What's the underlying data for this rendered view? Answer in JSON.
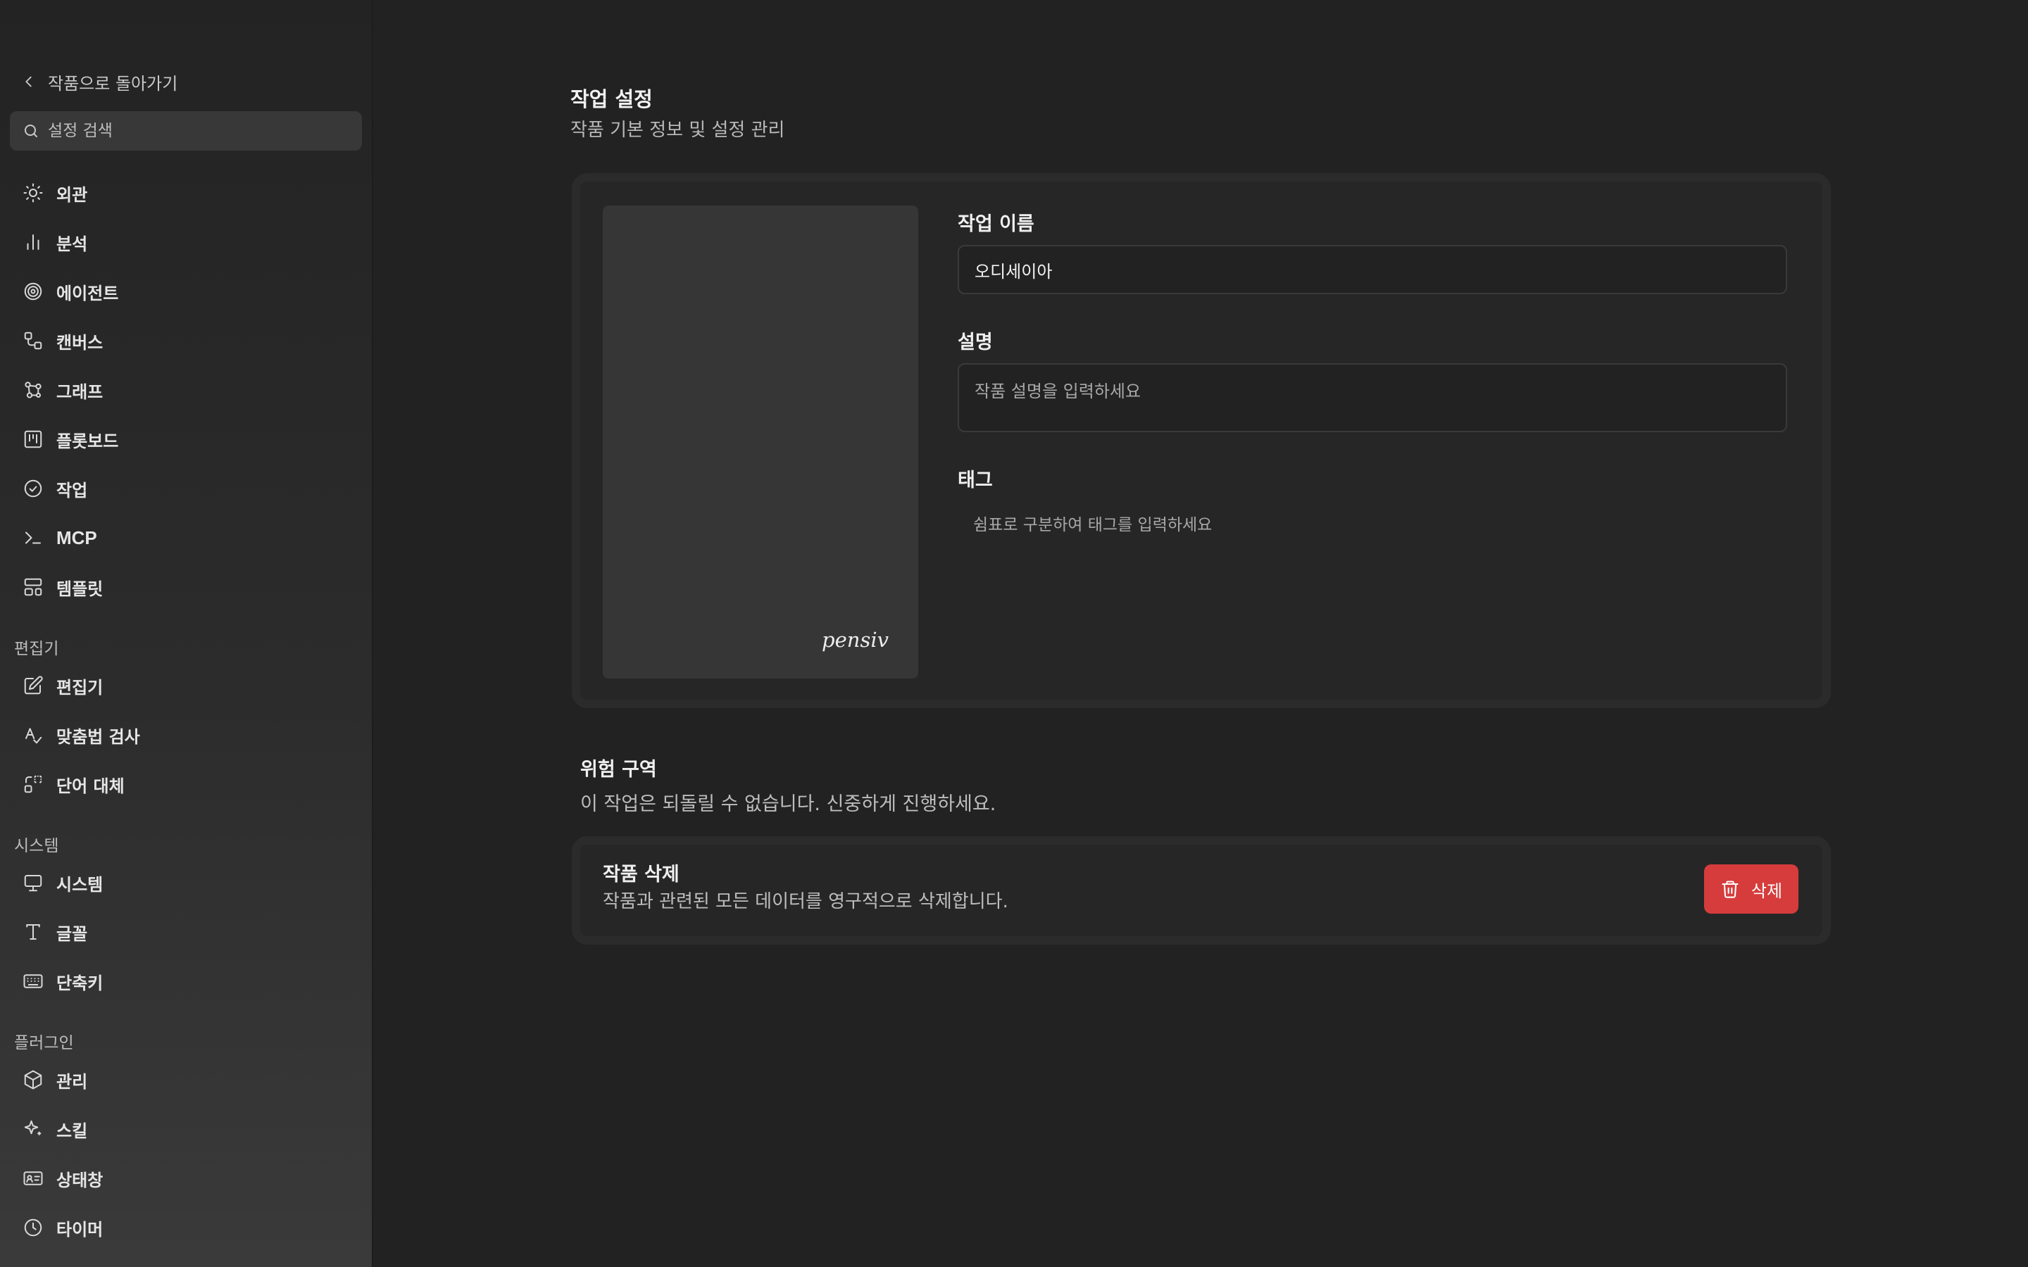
{
  "sidebar": {
    "back_label": "작품으로 돌아가기",
    "search_placeholder": "설정 검색",
    "items": [
      {
        "label": "외관",
        "icon": "sun-icon"
      },
      {
        "label": "분석",
        "icon": "bar-chart-icon"
      },
      {
        "label": "에이전트",
        "icon": "spiral-icon"
      },
      {
        "label": "캔버스",
        "icon": "workflow-icon"
      },
      {
        "label": "그래프",
        "icon": "graph-icon"
      },
      {
        "label": "플롯보드",
        "icon": "kanban-icon"
      },
      {
        "label": "작업",
        "icon": "check-circle-icon"
      },
      {
        "label": "MCP",
        "icon": "terminal-icon"
      },
      {
        "label": "템플릿",
        "icon": "layout-template-icon"
      }
    ],
    "sections": [
      {
        "title": "편집기",
        "items": [
          {
            "label": "편집기",
            "icon": "edit-icon"
          },
          {
            "label": "맞춤법 검사",
            "icon": "spell-check-icon"
          },
          {
            "label": "단어 대체",
            "icon": "replace-icon"
          }
        ]
      },
      {
        "title": "시스템",
        "items": [
          {
            "label": "시스템",
            "icon": "monitor-icon"
          },
          {
            "label": "글꼴",
            "icon": "type-icon"
          },
          {
            "label": "단축키",
            "icon": "keyboard-icon"
          }
        ]
      },
      {
        "title": "플러그인",
        "items": [
          {
            "label": "관리",
            "icon": "package-icon"
          },
          {
            "label": "스킬",
            "icon": "sparkles-icon"
          },
          {
            "label": "상태창",
            "icon": "id-card-icon"
          },
          {
            "label": "타이머",
            "icon": "clock-icon"
          }
        ]
      }
    ]
  },
  "main": {
    "title": "작업 설정",
    "subtitle": "작품 기본 정보 및 설정 관리",
    "cover_logo": "pensiv",
    "name_label": "작업 이름",
    "name_value": "오디세이아",
    "description_label": "설명",
    "description_placeholder": "작품 설명을 입력하세요",
    "tags_label": "태그",
    "tags_placeholder": "쉼표로 구분하여 태그를 입력하세요"
  },
  "danger_zone": {
    "title": "위험 구역",
    "description": "이 작업은 되돌릴 수 없습니다. 신중하게 진행하세요.",
    "delete_title": "작품 삭제",
    "delete_description": "작품과 관련된 모든 데이터를 영구적으로 삭제합니다.",
    "delete_button": "삭제",
    "button_color": "#d63c3c"
  }
}
